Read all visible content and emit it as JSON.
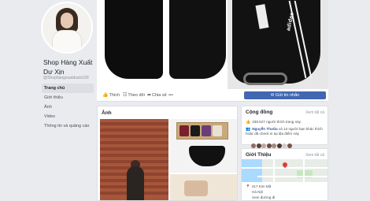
{
  "profile": {
    "name": "Shop Hàng Xuất Dư Xịn",
    "handle": "@Shophangxuatduxin199"
  },
  "nav": {
    "items": [
      {
        "label": "Trang chủ",
        "active": true
      },
      {
        "label": "Giới thiệu"
      },
      {
        "label": "Ảnh"
      },
      {
        "label": "Video"
      },
      {
        "label": "Thông tin và quảng cáo"
      }
    ]
  },
  "cover": {
    "brand_text": "adidas"
  },
  "actions": {
    "like": "Thích",
    "follow": "Theo dõi",
    "share": "Chia sẻ",
    "more": "•••",
    "message": "Gửi tin nhắn"
  },
  "photos": {
    "title": "Ảnh"
  },
  "community": {
    "title": "Cộng đồng",
    "see_all": "Xem tất cả",
    "likes": "338.527 người thích trang này",
    "friend_name": "Nguyễn Thưũa",
    "friend_text": "và 14 người bạn khác thích hoặc đã check in tại địa điểm này"
  },
  "about": {
    "title": "Giới Thiệu",
    "see_all": "Xem tất cả",
    "address_line1": "417 Kim Mã",
    "address_line2": "Hà Nội",
    "address_line3": "Xem đường đi"
  },
  "colors": {
    "facebook_blue": "#4267b2",
    "link": "#385898",
    "background": "#e9ebee"
  }
}
